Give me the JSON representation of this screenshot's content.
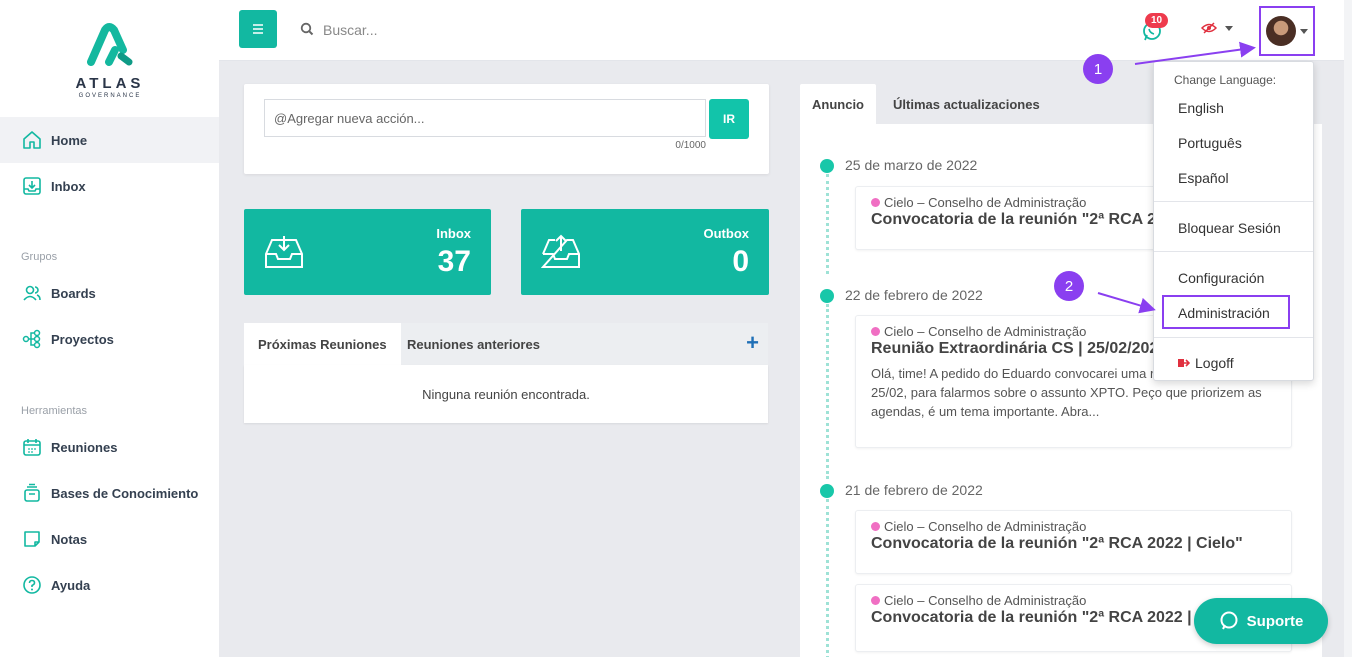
{
  "brand": {
    "name": "ATLAS",
    "tagline": "GOVERNANCE",
    "accent": "#12b8a1"
  },
  "sidebar": {
    "items": [
      {
        "label": "Home",
        "icon": "home-icon",
        "active": true
      },
      {
        "label": "Inbox",
        "icon": "inbox-icon"
      }
    ],
    "groups": [
      {
        "title": "Grupos",
        "items": [
          {
            "label": "Boards",
            "icon": "users-icon"
          },
          {
            "label": "Proyectos",
            "icon": "project-icon"
          }
        ]
      },
      {
        "title": "Herramientas",
        "items": [
          {
            "label": "Reuniones",
            "icon": "calendar-icon"
          },
          {
            "label": "Bases de Conocimiento",
            "icon": "knowledge-icon"
          },
          {
            "label": "Notas",
            "icon": "note-icon"
          },
          {
            "label": "Ayuda",
            "icon": "help-icon"
          }
        ]
      }
    ]
  },
  "topbar": {
    "search_placeholder": "Buscar...",
    "chat_badge": "10"
  },
  "action": {
    "placeholder": "@Agregar nueva acción...",
    "button": "IR",
    "counter": "0/1000"
  },
  "stats": [
    {
      "label": "Inbox",
      "value": "37"
    },
    {
      "label": "Outbox",
      "value": "0"
    }
  ],
  "meetings": {
    "tabs": [
      "Próximas Reuniones",
      "Reuniones anteriores"
    ],
    "empty": "Ninguna reunión encontrada."
  },
  "news": {
    "tabs": [
      "Anuncio",
      "Últimas actualizaciones"
    ],
    "dates": [
      "25 de marzo de 2022",
      "22 de febrero de 2022",
      "21 de febrero de 2022"
    ],
    "cards": [
      {
        "org": "Cielo – Conselho de Administração",
        "title": "Convocatoria de la reunión \"2ª RCA 2022 | Cielo\""
      },
      {
        "org": "Cielo – Conselho de Administração",
        "title": "Reunião Extraordinária CS | 25/02/2022",
        "body": "Olá, time! A pedido do Eduardo convocarei uma reunião para o dia 25/02, para falarmos sobre o assunto XPTO.  Peço que priorizem as agendas, é um tema importante.  Abra..."
      },
      {
        "org": "Cielo – Conselho de Administração",
        "title": "Convocatoria de la reunión \"2ª RCA 2022 | Cielo\""
      },
      {
        "org": "Cielo – Conselho de Administração",
        "title": "Convocatoria de la reunión \"2ª RCA 2022 | Cielo\""
      }
    ]
  },
  "dropdown": {
    "heading": "Change Language:",
    "languages": [
      "English",
      "Português",
      "Español"
    ],
    "lock": "Bloquear Sesión",
    "config": "Configuración",
    "admin": "Administración",
    "logoff": "Logoff"
  },
  "annotations": [
    "1",
    "2"
  ],
  "support": "Suporte"
}
